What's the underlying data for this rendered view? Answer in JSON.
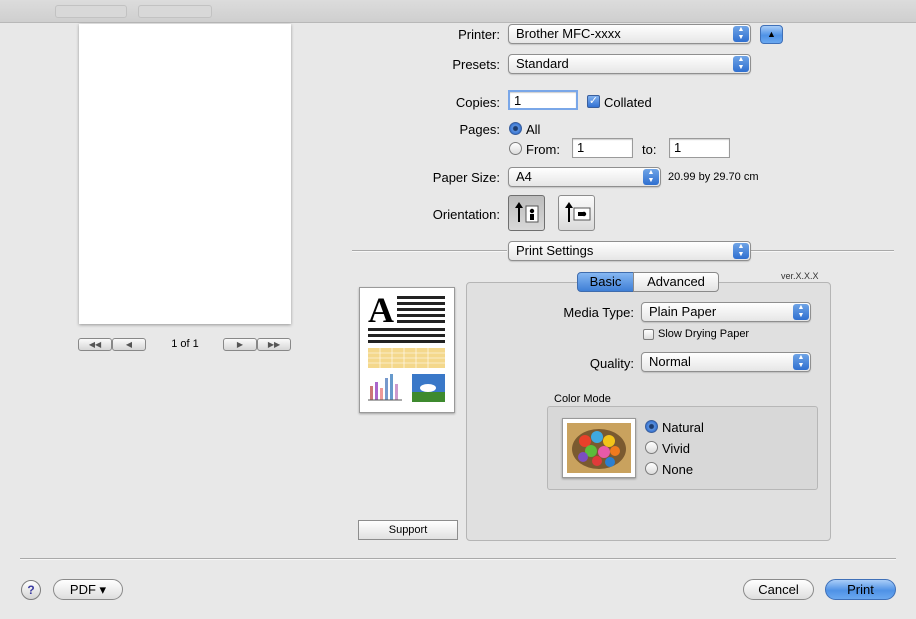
{
  "preview": {
    "page_indicator": "1 of 1"
  },
  "printer": {
    "label": "Printer:",
    "value": "Brother MFC-xxxx"
  },
  "presets": {
    "label": "Presets:",
    "value": "Standard"
  },
  "copies": {
    "label": "Copies:",
    "value": "1",
    "collated_label": "Collated",
    "collated_checked": true
  },
  "pages": {
    "label": "Pages:",
    "all_label": "All",
    "all_selected": true,
    "from_label": "From:",
    "from_value": "1",
    "to_label": "to:",
    "to_value": "1"
  },
  "paper_size": {
    "label": "Paper Size:",
    "value": "A4",
    "dimensions": "20.99 by 29.70 cm"
  },
  "orientation": {
    "label": "Orientation:",
    "selected": "portrait"
  },
  "section_popup": {
    "value": "Print Settings"
  },
  "driver": {
    "version": "ver.X.X.X",
    "tabs": [
      {
        "label": "Basic",
        "selected": true
      },
      {
        "label": "Advanced",
        "selected": false
      }
    ],
    "support_label": "Support",
    "media_type": {
      "label": "Media Type:",
      "value": "Plain Paper"
    },
    "slow_drying": {
      "label": "Slow Drying Paper",
      "checked": false
    },
    "quality": {
      "label": "Quality:",
      "value": "Normal"
    },
    "color_mode": {
      "label": "Color Mode",
      "options": [
        "Natural",
        "Vivid",
        "None"
      ],
      "selected": "Natural"
    }
  },
  "footer": {
    "help_label": "?",
    "pdf_label": "PDF ▾",
    "cancel_label": "Cancel",
    "print_label": "Print"
  },
  "colors": {
    "accent_blue": "#3f7fd6",
    "background": "#e8e8e8"
  }
}
